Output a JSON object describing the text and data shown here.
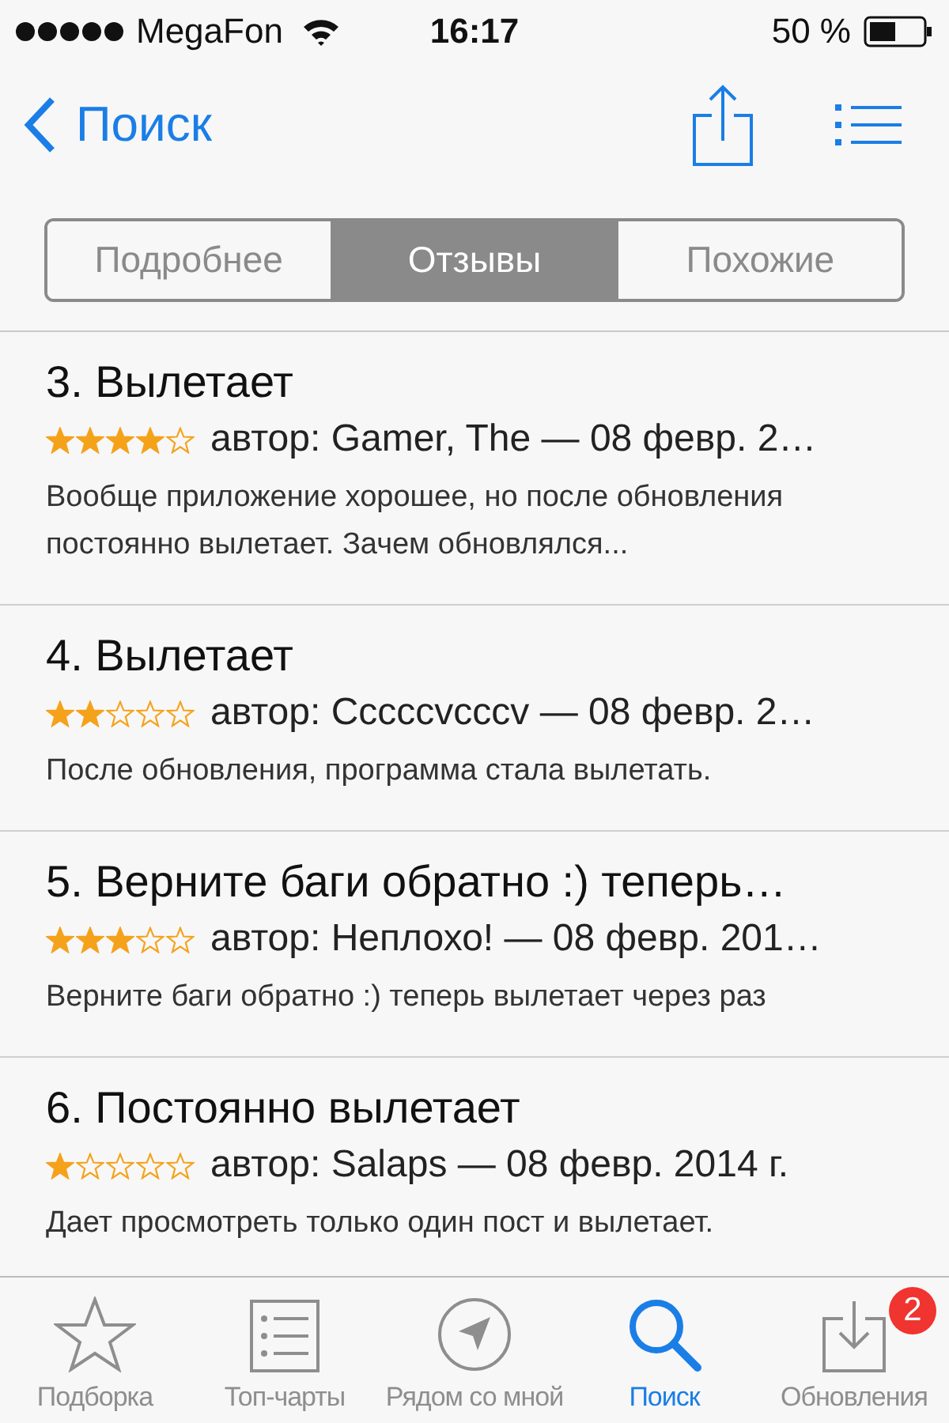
{
  "status_bar": {
    "carrier": "MegaFon",
    "time": "16:17",
    "battery": "50 %"
  },
  "nav": {
    "back": "Поиск"
  },
  "segments": [
    {
      "label": "Подробнее",
      "selected": false
    },
    {
      "label": "Отзывы",
      "selected": true
    },
    {
      "label": "Похожие",
      "selected": false
    }
  ],
  "reviews": [
    {
      "title": "3. Вылетает",
      "stars": 4,
      "meta": "автор: Gamer, The — 08 февр. 2…",
      "body": "Вообще приложение хорошее, но после обновления постоянно вылетает. Зачем обновлялся..."
    },
    {
      "title": "4. Вылетает",
      "stars": 2,
      "meta": "автор: Cccccvcccv — 08 февр. 2…",
      "body": "После обновления, программа стала вылетать."
    },
    {
      "title": "5. Верните баги обратно :) теперь…",
      "stars": 3,
      "meta": "автор: Неплохо! — 08 февр. 201…",
      "body": "Верните баги обратно :) теперь вылетает через раз"
    },
    {
      "title": "6. Постоянно вылетает",
      "stars": 1,
      "meta": "автор: Salaps — 08 февр. 2014 г.",
      "body": "Дает просмотреть только один пост и вылетает."
    }
  ],
  "tab_bar": [
    {
      "kind": "featured",
      "label": "Подборка",
      "selected": false
    },
    {
      "kind": "charts",
      "label": "Топ-чарты",
      "selected": false
    },
    {
      "kind": "nearby",
      "label": "Рядом со мной",
      "selected": false
    },
    {
      "kind": "search",
      "label": "Поиск",
      "selected": true
    },
    {
      "kind": "updates",
      "label": "Обновления",
      "selected": false,
      "badge": "2"
    }
  ]
}
